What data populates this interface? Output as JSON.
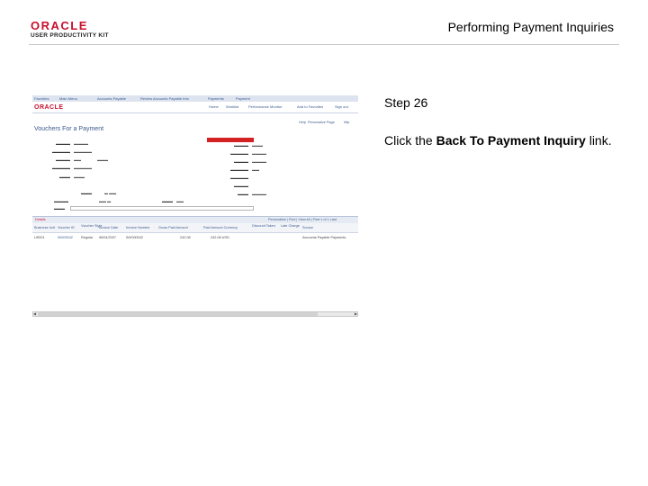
{
  "header": {
    "logo_oracle": "ORACLE",
    "logo_upk": "USER PRODUCTIVITY KIT",
    "title": "Performing Payment Inquiries"
  },
  "screenshot": {
    "nav": [
      "Favorites",
      "Main Menu",
      "Accounts Payable",
      "Review Accounts Payable Info",
      "Payments",
      "Payment"
    ],
    "top_links": [
      "Home",
      "Worklist",
      "Performance Monitor",
      "Add to Favorites",
      "Sign out"
    ],
    "brand": "ORACLE",
    "help_links": [
      "Help",
      "Personalize Page",
      "http"
    ],
    "page_heading": "Vouchers For a Payment",
    "grid_title": "Details",
    "grid_nav": "Personalize | Find | View All | First 1 of 1 Last",
    "grid_columns": [
      "Business Unit",
      "Voucher ID",
      "Voucher Style",
      "Invoice Date",
      "Invoice Number",
      "Gross Paid Amount",
      "Paid Amount Currency",
      "Discount Taken",
      "Late Charge",
      "Source"
    ],
    "grid_row": [
      "US001",
      "00000042",
      "Regular",
      "06/04/2007",
      "INV000042",
      "242.08",
      "242.08 USD",
      "",
      "",
      "Accounts Payable Payments"
    ]
  },
  "step": {
    "label": "Step 26",
    "text_before": "Click the ",
    "link_text": "Back To Payment Inquiry",
    "text_after": " link."
  }
}
